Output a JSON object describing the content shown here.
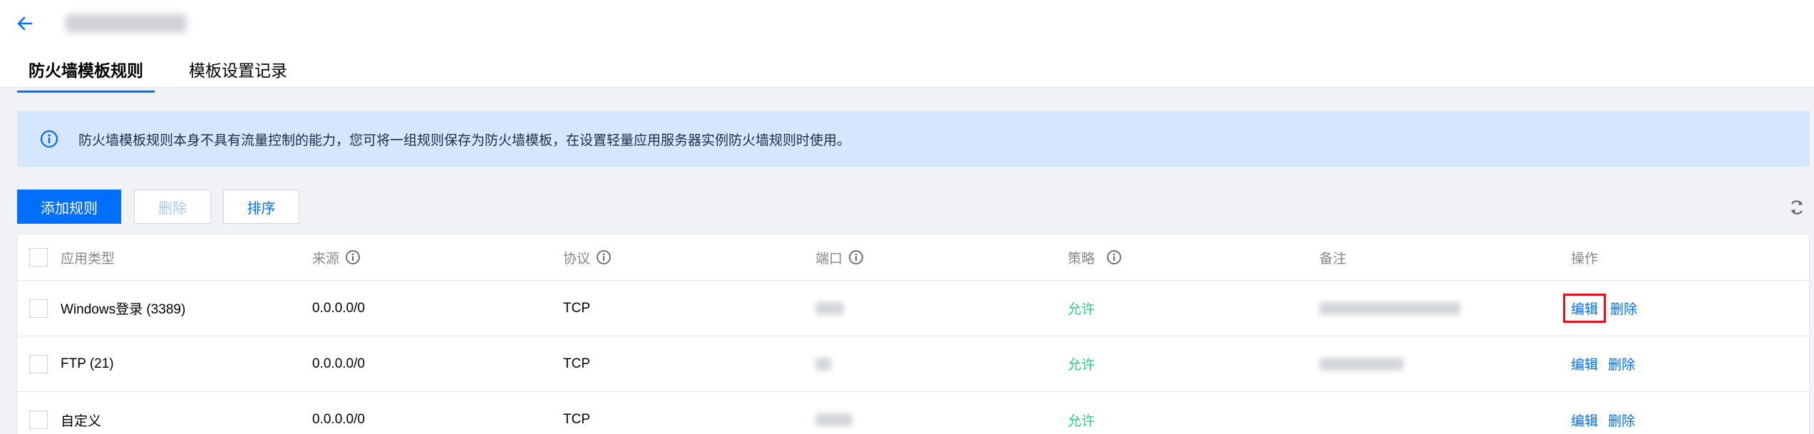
{
  "header": {
    "tabs": [
      {
        "label": "防火墙模板规则",
        "active": true
      },
      {
        "label": "模板设置记录",
        "active": false
      }
    ]
  },
  "notice": {
    "text": "防火墙模板规则本身不具有流量控制的能力，您可将一组规则保存为防火墙模板，在设置轻量应用服务器实例防火墙规则时使用。"
  },
  "toolbar": {
    "add_label": "添加规则",
    "delete_label": "删除",
    "sort_label": "排序"
  },
  "table": {
    "columns": [
      "应用类型",
      "来源",
      "协议",
      "端口",
      "策略",
      "备注",
      "操作"
    ],
    "rows": [
      {
        "type": "Windows登录 (3389)",
        "source": "0.0.0.0/0",
        "protocol": "TCP",
        "policy": "允许",
        "edit": "编辑",
        "delete": "删除"
      },
      {
        "type": "FTP (21)",
        "source": "0.0.0.0/0",
        "protocol": "TCP",
        "policy": "允许",
        "edit": "编辑",
        "delete": "删除"
      },
      {
        "type": "自定义",
        "source": "0.0.0.0/0",
        "protocol": "TCP",
        "policy": "允许",
        "edit": "编辑",
        "delete": "删除"
      }
    ]
  },
  "colors": {
    "primary": "#006eff",
    "allow": "#29cc85",
    "highlight": "#e5101a",
    "notice_bg": "#d5e7ff"
  }
}
